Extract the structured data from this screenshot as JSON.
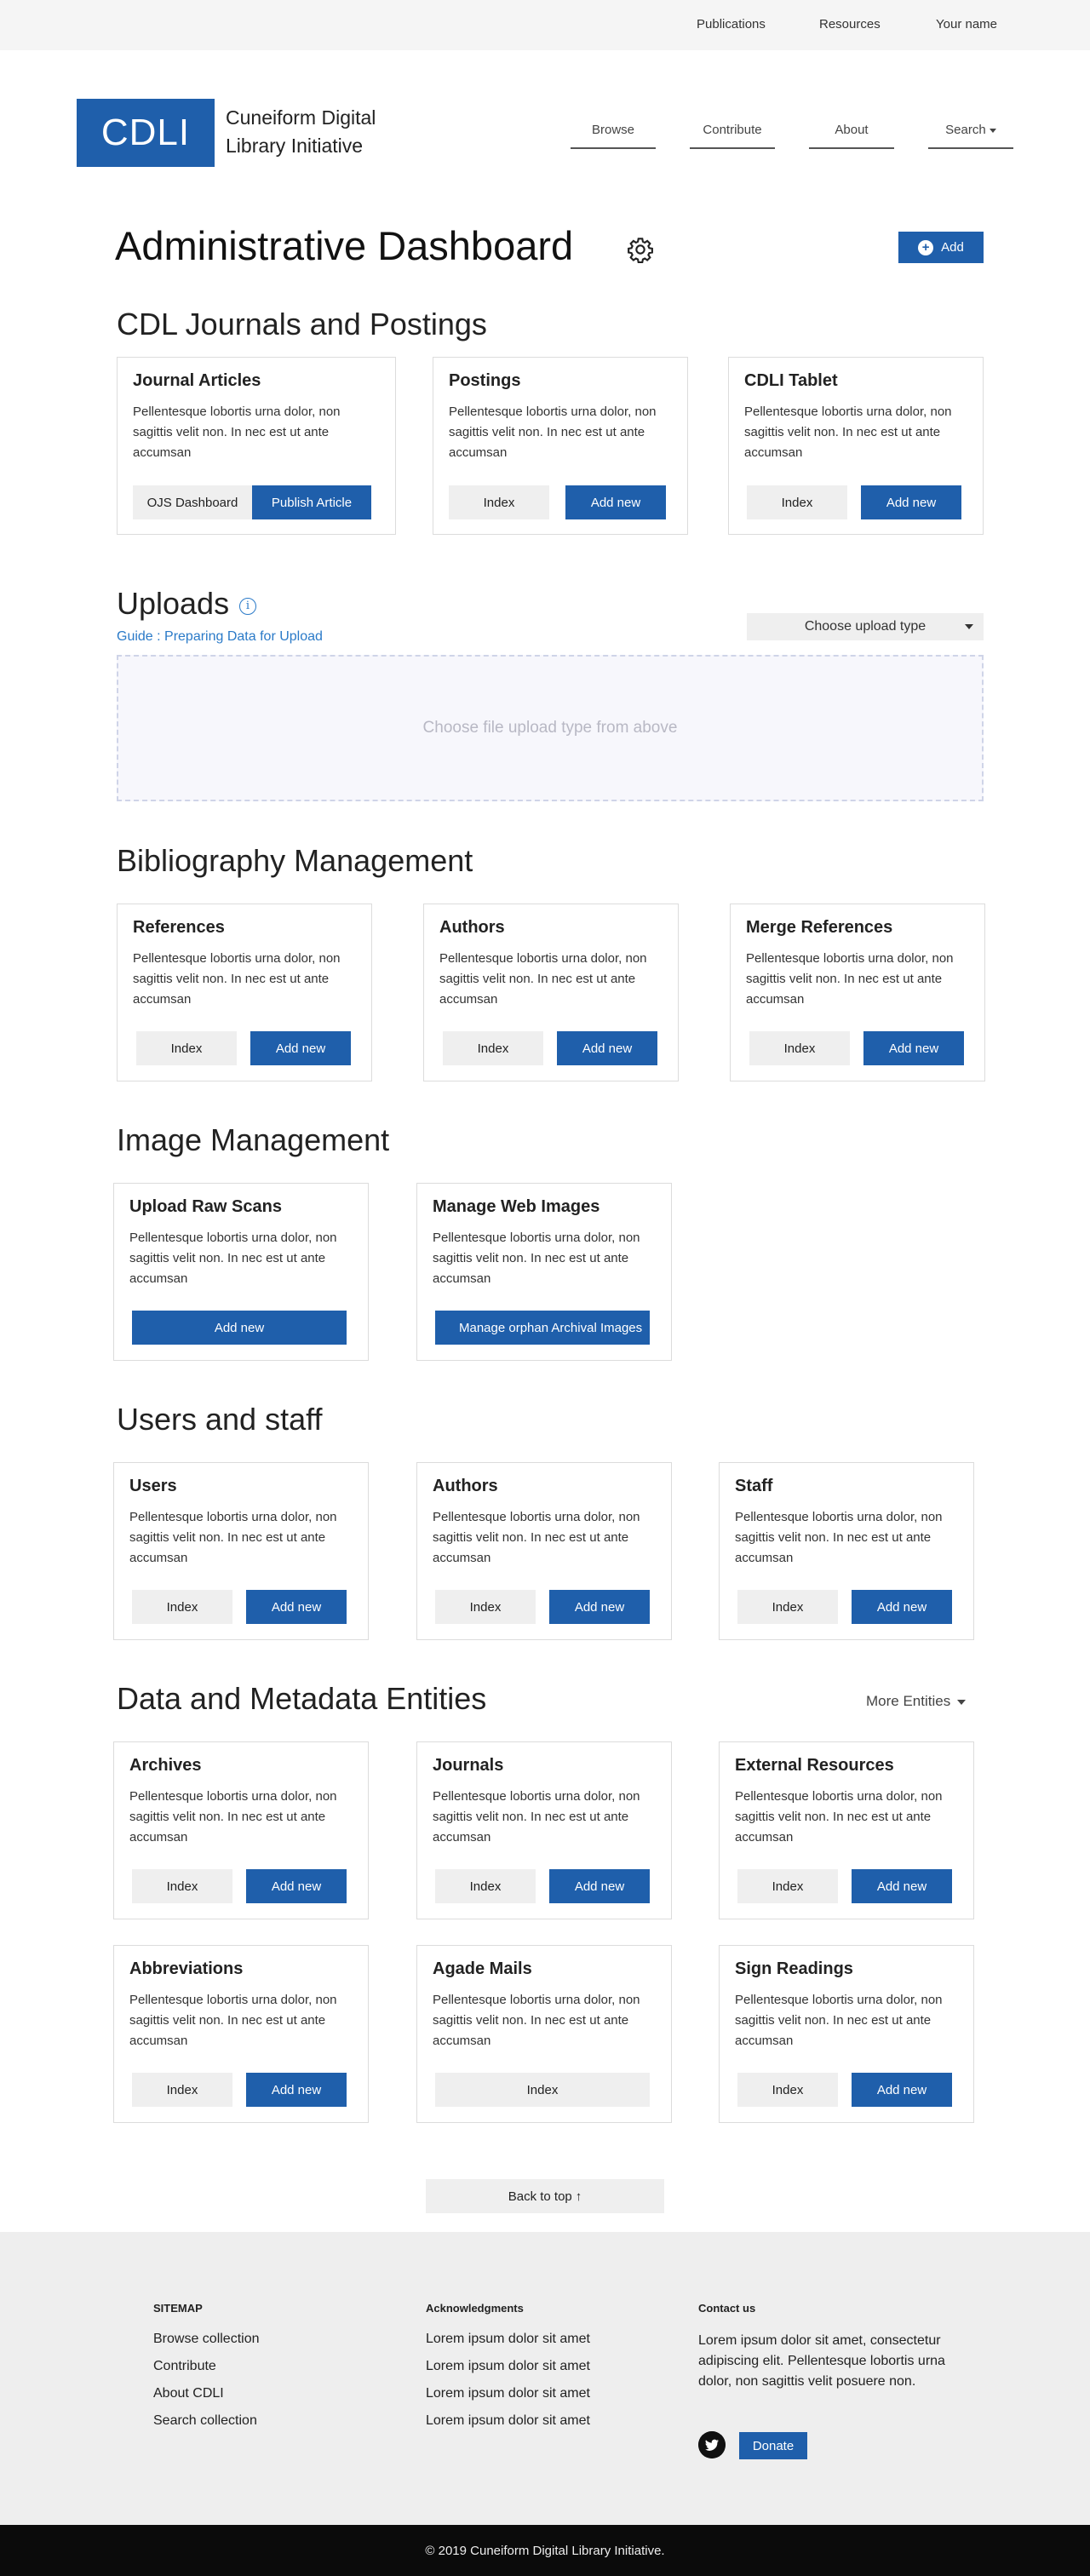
{
  "topbar": {
    "publications": "Publications",
    "resources": "Resources",
    "user": "Your name"
  },
  "logo": {
    "abbr": "CDLI",
    "line1": "Cuneiform Digital",
    "line2": "Library Initiative"
  },
  "nav": {
    "browse": "Browse",
    "contribute": "Contribute",
    "about": "About",
    "search": "Search"
  },
  "page": {
    "title": "Administrative Dashboard",
    "add_label": "Add"
  },
  "lorem": "Pellentesque lobortis urna dolor, non sagittis velit non. In nec est ut ante accumsan",
  "journals": {
    "title": "CDL Journals and Postings",
    "cards": [
      {
        "title": "Journal Articles",
        "btn1": "OJS Dashboard",
        "btn2": "Publish Article"
      },
      {
        "title": "Postings",
        "btn1": "Index",
        "btn2": "Add new"
      },
      {
        "title": "CDLI Tablet",
        "btn1": "Index",
        "btn2": "Add new"
      }
    ]
  },
  "uploads": {
    "title": "Uploads",
    "guide": "Guide : Preparing Data for Upload",
    "select": "Choose upload type",
    "dropzone": "Choose file upload type from above"
  },
  "bibliography": {
    "title": "Bibliography Management",
    "cards": [
      {
        "title": "References",
        "btn1": "Index",
        "btn2": "Add new"
      },
      {
        "title": "Authors",
        "btn1": "Index",
        "btn2": "Add new"
      },
      {
        "title": "Merge References",
        "btn1": "Index",
        "btn2": "Add new"
      }
    ]
  },
  "images": {
    "title": "Image Management",
    "cards": [
      {
        "title": "Upload Raw Scans",
        "btn": "Add new"
      },
      {
        "title": "Manage Web Images",
        "btn": "Manage orphan Archival Images"
      }
    ]
  },
  "users": {
    "title": "Users and staff",
    "cards": [
      {
        "title": "Users",
        "btn1": "Index",
        "btn2": "Add new"
      },
      {
        "title": "Authors",
        "btn1": "Index",
        "btn2": "Add new"
      },
      {
        "title": "Staff",
        "btn1": "Index",
        "btn2": "Add new"
      }
    ]
  },
  "entities": {
    "title": "Data and Metadata Entities",
    "more": "More Entities",
    "cards": [
      {
        "title": "Archives",
        "btn1": "Index",
        "btn2": "Add new"
      },
      {
        "title": "Journals",
        "btn1": "Index",
        "btn2": "Add new"
      },
      {
        "title": "External Resources",
        "btn1": "Index",
        "btn2": "Add new"
      },
      {
        "title": "Abbreviations",
        "btn1": "Index",
        "btn2": "Add new"
      },
      {
        "title": "Agade Mails",
        "btn1": "Index"
      },
      {
        "title": "Sign Readings",
        "btn1": "Index",
        "btn2": "Add new"
      }
    ]
  },
  "back_to_top": "Back to top",
  "footer": {
    "sitemap": {
      "title": "SITEMAP",
      "links": [
        "Browse collection",
        "Contribute",
        "About CDLI",
        "Search collection"
      ]
    },
    "ack": {
      "title": "Acknowledgments",
      "links": [
        "Lorem ipsum dolor sit amet",
        "Lorem ipsum dolor sit amet",
        "Lorem ipsum dolor sit amet",
        "Lorem ipsum dolor sit amet"
      ]
    },
    "contact": {
      "title": "Contact us",
      "text": "Lorem ipsum dolor sit amet, consectetur adipiscing elit. Pellentesque lobortis urna dolor, non sagittis velit posuere non."
    },
    "donate": "Donate"
  },
  "copyright": "© 2019 Cuneiform Digital Library Initiative.",
  "colors": {
    "primary": "#1f5fab",
    "link": "#2a7ac8",
    "button_grey": "#efefef",
    "footer_bg": "#eeeeee",
    "bottom_bar": "#0b0b0b"
  }
}
